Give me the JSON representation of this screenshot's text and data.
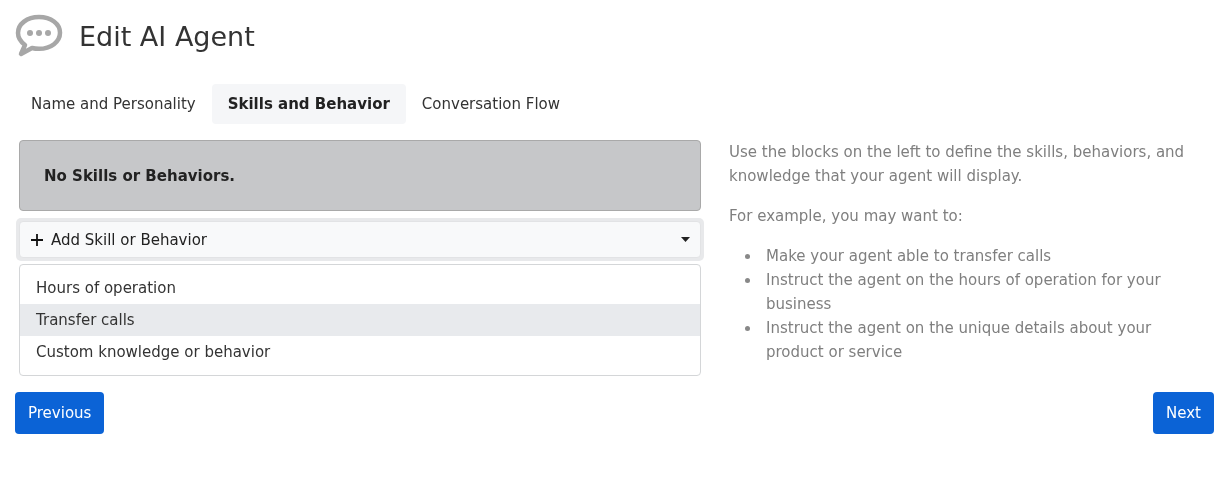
{
  "header": {
    "title": "Edit AI Agent"
  },
  "tabs": [
    {
      "label": "Name and Personality",
      "selected": false
    },
    {
      "label": "Skills and Behavior",
      "selected": true
    },
    {
      "label": "Conversation Flow",
      "selected": false
    }
  ],
  "skills": {
    "empty_message": "No Skills or Behaviors.",
    "add_button": {
      "label": "Add Skill or Behavior",
      "expanded": true
    },
    "menu_items": [
      {
        "label": "Hours of operation",
        "selected": false
      },
      {
        "label": "Transfer calls",
        "selected": true
      },
      {
        "label": "Custom knowledge or behavior",
        "selected": false
      }
    ]
  },
  "help": {
    "intro": "Use the blocks on the left to define the skills, behaviors, and knowledge that your agent will display.",
    "lead": "For example, you may want to:",
    "items": [
      "Make your agent able to transfer calls",
      "Instruct the agent on the hours of operation for your business",
      "Instruct the agent on the unique details about your product or service"
    ]
  },
  "buttons": {
    "previous": "Previous",
    "next": "Next"
  }
}
